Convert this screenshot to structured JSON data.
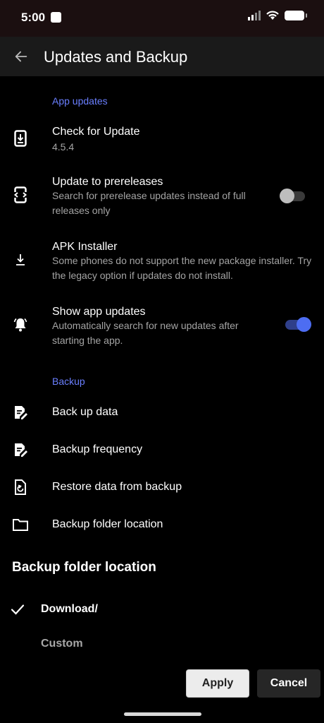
{
  "status_bar": {
    "time": "5:00"
  },
  "app_bar": {
    "title": "Updates and Backup"
  },
  "sections": {
    "app_updates": "App updates",
    "backup": "Backup"
  },
  "items": {
    "check_update": {
      "title": "Check for Update",
      "sub": "4.5.4"
    },
    "prereleases": {
      "title": "Update to prereleases",
      "sub": "Search for prerelease updates instead of full releases only",
      "enabled": false
    },
    "apk_installer": {
      "title": "APK Installer",
      "sub": "Some phones do not support the new package installer. Try the legacy option if updates do not install."
    },
    "show_updates": {
      "title": "Show app updates",
      "sub": "Automatically search for new updates after starting the app.",
      "enabled": true
    },
    "back_up_data": {
      "title": "Back up data"
    },
    "backup_frequency": {
      "title": "Backup frequency"
    },
    "restore_data": {
      "title": "Restore data from backup"
    },
    "backup_folder": {
      "title": "Backup folder location"
    }
  },
  "dialog": {
    "title": "Backup folder location",
    "options": [
      {
        "label": "Download/",
        "selected": true
      },
      {
        "label": "Custom",
        "selected": false
      }
    ],
    "apply_label": "Apply",
    "cancel_label": "Cancel"
  },
  "colors": {
    "accent": "#4d6df2",
    "section_header": "#6a7fff",
    "background": "#000000"
  },
  "icons": {
    "back": "arrow-left-icon",
    "check_update": "phone-download-icon",
    "prereleases": "phone-code-icon",
    "apk": "download-icon",
    "show_updates": "bell-ring-icon",
    "backup": "file-edit-icon",
    "frequency": "file-edit-icon",
    "restore": "file-restore-icon",
    "folder": "folder-icon",
    "check": "check-icon"
  }
}
